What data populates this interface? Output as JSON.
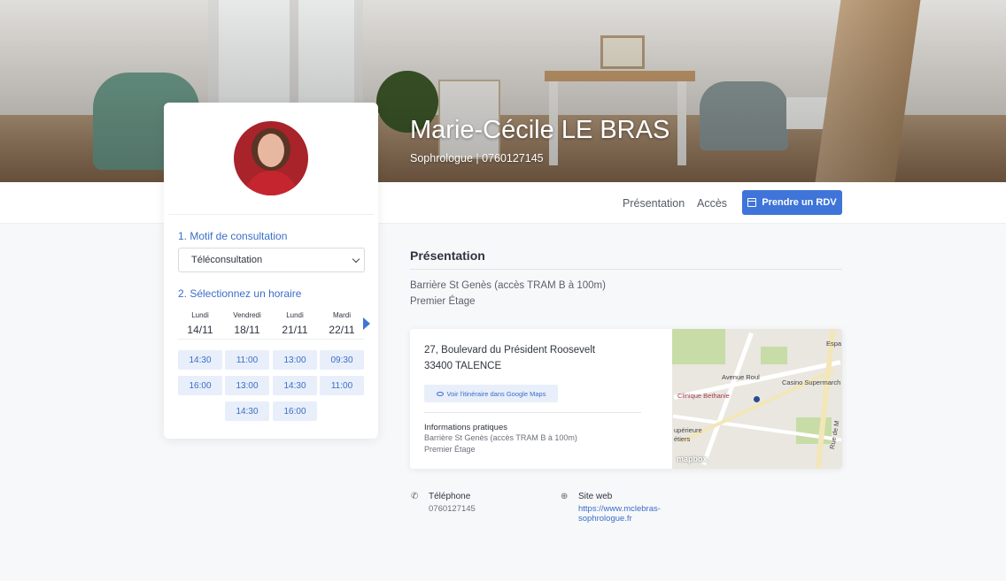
{
  "profile": {
    "name": "Marie-Cécile LE BRAS",
    "subtitle": "Sophrologue | 0760127145"
  },
  "nav": {
    "presentation": "Présentation",
    "acces": "Accès",
    "rdv_button": "Prendre un RDV"
  },
  "booking": {
    "step1_title": "1. Motif de consultation",
    "motif_selected": "Téléconsultation",
    "step2_title": "2. Sélectionnez un horaire",
    "days": [
      {
        "name": "Lundi",
        "date": "14/11",
        "slots": [
          "14:30",
          "16:00"
        ]
      },
      {
        "name": "Vendredi",
        "date": "18/11",
        "slots": [
          "11:00",
          "13:00",
          "14:30"
        ]
      },
      {
        "name": "Lundi",
        "date": "21/11",
        "slots": [
          "13:00",
          "14:30",
          "16:00"
        ]
      },
      {
        "name": "Mardi",
        "date": "22/11",
        "slots": [
          "09:30",
          "11:00"
        ]
      }
    ]
  },
  "presentation": {
    "title": "Présentation",
    "lines": [
      "Barrière St Genès (accès TRAM B à 100m)",
      "Premier Étage"
    ]
  },
  "address": {
    "street": "27, Boulevard du Président Roosevelt",
    "city": "33400 TALENCE",
    "maps_button": "Voir l'itinéraire dans Google Maps",
    "info_title": "Informations pratiques",
    "info_lines": [
      "Barrière St Genès (accès TRAM B à 100m)",
      "Premier Étage"
    ]
  },
  "map": {
    "labels": [
      "Espa",
      "Avenue Roul",
      "Casino Supermarch",
      "Clinique Bethanie",
      "upérieure",
      "étiers",
      "Rue de M"
    ],
    "attribution": "mapbox"
  },
  "contact": {
    "phone_label": "Téléphone",
    "phone_value": "0760127145",
    "web_label": "Site web",
    "web_value": "https://www.mclebras-sophrologue.fr"
  },
  "icons": {
    "calendar": "calendar-icon",
    "eye": "eye-icon",
    "phone": "phone-icon",
    "globe": "globe-icon",
    "next": "chevron-right-icon"
  },
  "colors": {
    "accent": "#3f74d9",
    "slot_bg": "#e8eefa",
    "slot_text": "#3a6ec8"
  }
}
